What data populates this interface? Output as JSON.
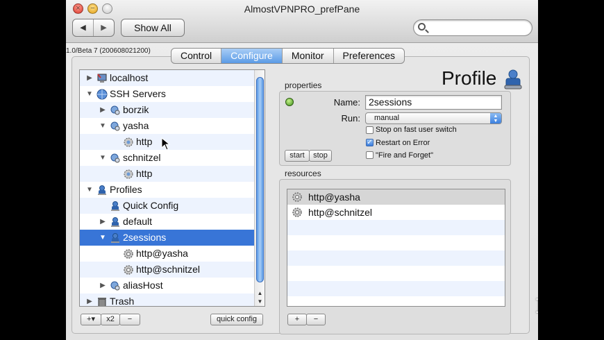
{
  "window": {
    "title": "AlmostVPNPRO_prefPane"
  },
  "toolbar": {
    "back": "◀",
    "forward": "▶",
    "show_all": "Show All",
    "search_placeholder": ""
  },
  "version": "1.0/Beta 7 (200608021200)",
  "tabs": [
    {
      "label": "Control",
      "active": false
    },
    {
      "label": "Configure",
      "active": true
    },
    {
      "label": "Monitor",
      "active": false
    },
    {
      "label": "Preferences",
      "active": false
    }
  ],
  "outline": {
    "rows": [
      {
        "label": "localhost",
        "icon": "computer-icon",
        "disclosure": "collapsed",
        "level": 0
      },
      {
        "label": "SSH Servers",
        "icon": "globe-icon",
        "disclosure": "expanded",
        "level": 0
      },
      {
        "label": "borzik",
        "icon": "server-icon",
        "disclosure": "collapsed",
        "level": 1
      },
      {
        "label": "yasha",
        "icon": "server-icon",
        "disclosure": "expanded",
        "level": 1
      },
      {
        "label": "http",
        "icon": "service-icon",
        "disclosure": "none",
        "level": 2
      },
      {
        "label": "schnitzel",
        "icon": "server-icon",
        "disclosure": "expanded",
        "level": 1
      },
      {
        "label": "http",
        "icon": "service-icon",
        "disclosure": "none",
        "level": 2
      },
      {
        "label": "Profiles",
        "icon": "profile-icon",
        "disclosure": "expanded",
        "level": 0
      },
      {
        "label": "Quick Config",
        "icon": "profile-icon",
        "disclosure": "none",
        "level": 1
      },
      {
        "label": "default",
        "icon": "profile-icon",
        "disclosure": "collapsed",
        "level": 1
      },
      {
        "label": "2sessions",
        "icon": "profile-icon",
        "disclosure": "expanded",
        "level": 1,
        "selected": true
      },
      {
        "label": "http@yasha",
        "icon": "gear-icon",
        "disclosure": "none",
        "level": 2
      },
      {
        "label": "http@schnitzel",
        "icon": "gear-icon",
        "disclosure": "none",
        "level": 2
      },
      {
        "label": "aliasHost",
        "icon": "server-icon",
        "disclosure": "collapsed",
        "level": 1
      },
      {
        "label": "Trash",
        "icon": "trash-icon",
        "disclosure": "collapsed",
        "level": 0
      }
    ],
    "add_button": "+▾",
    "x2_button": "x2",
    "remove_button": "−",
    "quick_config_button": "quick config"
  },
  "profile_header": "Profile",
  "properties": {
    "group_label": "properties",
    "name_label": "Name:",
    "name_value": "2sessions",
    "run_label": "Run:",
    "run_value": "manual",
    "start_button": "start",
    "stop_button": "stop",
    "checkboxes": [
      {
        "label": "Stop on fast user switch",
        "checked": false
      },
      {
        "label": "Restart on Error",
        "checked": true
      },
      {
        "label": "\"Fire and Forget\"",
        "checked": false
      }
    ]
  },
  "resources": {
    "group_label": "resources",
    "items": [
      "http@yasha",
      "http@schnitzel"
    ],
    "add_button": "+",
    "remove_button": "−"
  },
  "watermark": "mu"
}
